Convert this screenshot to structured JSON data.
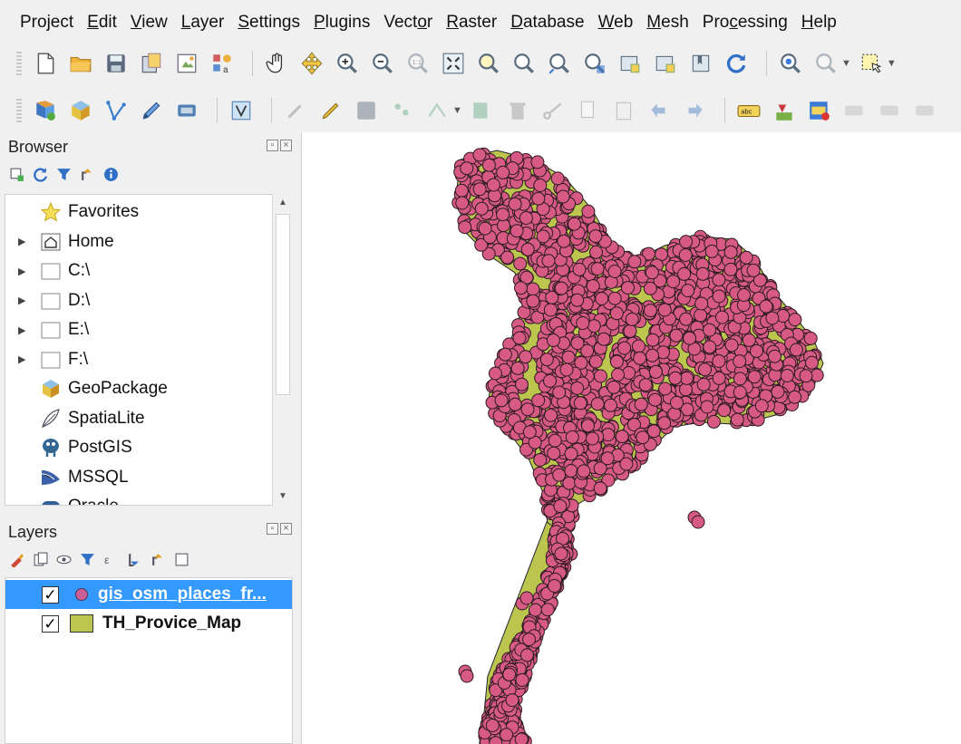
{
  "menubar": {
    "items": [
      {
        "label": "Project",
        "key": ""
      },
      {
        "label": "Edit",
        "key": "E"
      },
      {
        "label": "View",
        "key": "V"
      },
      {
        "label": "Layer",
        "key": "L"
      },
      {
        "label": "Settings",
        "key": "S"
      },
      {
        "label": "Plugins",
        "key": "P"
      },
      {
        "label": "Vector",
        "key": "o"
      },
      {
        "label": "Raster",
        "key": "R"
      },
      {
        "label": "Database",
        "key": "D"
      },
      {
        "label": "Web",
        "key": "W"
      },
      {
        "label": "Mesh",
        "key": "M"
      },
      {
        "label": "Processing",
        "key": "c"
      },
      {
        "label": "Help",
        "key": "H"
      }
    ]
  },
  "toolbar1": {
    "icons": [
      "new-project-icon",
      "open-project-icon",
      "save-project-icon",
      "save-as-icon",
      "print-layout-icon",
      "style-manager-icon",
      "pan-hand-icon",
      "pan-to-selection-icon",
      "zoom-in-icon",
      "zoom-out-icon",
      "zoom-native-icon",
      "zoom-full-icon",
      "zoom-to-selection-icon",
      "zoom-to-layer-icon",
      "zoom-last-icon",
      "zoom-next-icon",
      "new-map-view-icon",
      "new-3d-view-icon",
      "new-bookmark-icon",
      "refresh-icon",
      "identify-icon",
      "select-icon"
    ]
  },
  "toolbar2": {
    "icons": [
      "data-source-manager-icon",
      "new-geopackage-icon",
      "digitize-vertex-icon",
      "digitize-pen-icon",
      "new-temp-layer-icon",
      "field-calculator-icon",
      "current-edits-icon",
      "toggle-editing-icon",
      "save-edits-icon",
      "add-feature-icon",
      "vertex-tool-icon",
      "modify-attributes-icon",
      "delete-selected-icon",
      "cut-features-icon",
      "copy-features-icon",
      "paste-features-icon",
      "undo-icon",
      "redo-icon",
      "label-abc-icon",
      "layer-diagram-icon",
      "label-highlight-icon",
      "pin-labels-icon",
      "show-hide-labels-icon",
      "move-label-icon"
    ]
  },
  "browser": {
    "title": "Browser",
    "items": [
      {
        "label": "Favorites",
        "icon": "star-icon",
        "expandable": false
      },
      {
        "label": "Home",
        "icon": "home-icon",
        "expandable": true
      },
      {
        "label": "C:\\",
        "icon": "folder-icon",
        "expandable": true
      },
      {
        "label": "D:\\",
        "icon": "folder-icon",
        "expandable": true
      },
      {
        "label": "E:\\",
        "icon": "folder-icon",
        "expandable": true
      },
      {
        "label": "F:\\",
        "icon": "folder-icon",
        "expandable": true
      },
      {
        "label": "GeoPackage",
        "icon": "geopackage-icon",
        "expandable": false
      },
      {
        "label": "SpatiaLite",
        "icon": "spatialite-icon",
        "expandable": false
      },
      {
        "label": "PostGIS",
        "icon": "postgis-icon",
        "expandable": false
      },
      {
        "label": "MSSQL",
        "icon": "mssql-icon",
        "expandable": false
      },
      {
        "label": "Oracle",
        "icon": "oracle-icon",
        "expandable": false
      }
    ]
  },
  "layers": {
    "title": "Layers",
    "items": [
      {
        "label": "gis_osm_places_fr...",
        "checked": true,
        "symbol": "point",
        "selected": true,
        "color": "#c9609a"
      },
      {
        "label": "TH_Provice_Map",
        "checked": true,
        "symbol": "polygon",
        "selected": false,
        "color": "#bcc64e"
      }
    ]
  },
  "colors": {
    "point_fill": "#d65a84",
    "point_stroke": "#2b1a22",
    "polygon_fill": "#bcc64e",
    "selection": "#3399ff"
  }
}
